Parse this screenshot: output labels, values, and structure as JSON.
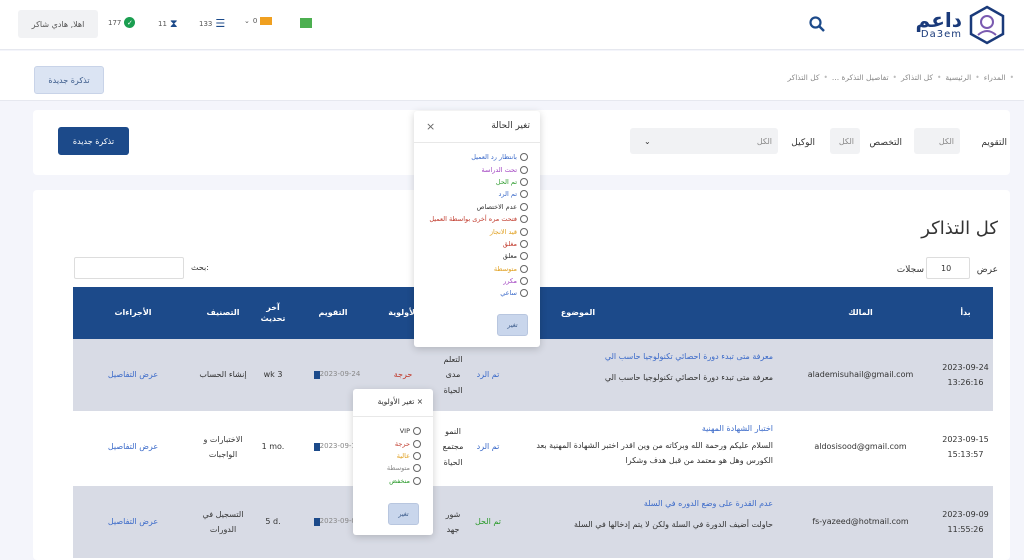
{
  "header": {
    "logo_ar": "داعم",
    "logo_en": "Da3em",
    "greeting": "اهلا, هادي شاكر",
    "stats": {
      "done_count": "177",
      "pending_count": "11",
      "list_count": "133",
      "chevron_count": "0"
    }
  },
  "subbar": {
    "new_ticket": "تذكرة جديدة",
    "breadcrumb": [
      "المدراء",
      "الرئيسية",
      "كل التذاكر",
      "تفاصيل التذكرة ...",
      "كل التذاكر"
    ]
  },
  "filters": {
    "new_ticket": "تذكرة جديدة",
    "rating_label": "التقويم",
    "rating_value": "الكل",
    "specialty_label": "التخصص",
    "specialty_value": "الكل",
    "agent_label": "الوكيل",
    "agent_value": "الكل"
  },
  "main": {
    "title": "كل التذاكر",
    "show_label": "عرض",
    "show_value": "10",
    "records_label": "سجلات",
    "search_label": "بحث:"
  },
  "table": {
    "headers": {
      "start": "بدأ",
      "owner": "المالك",
      "subject": "الموضوع",
      "priority": "الأولوية",
      "rating": "التقويم",
      "last_update": "آخر تحديث",
      "category": "التصنيف",
      "actions": "الأجراءات"
    },
    "rows": [
      {
        "date": "2023-09-24",
        "time": "13:26:16",
        "owner": "alademisuhail@gmail.com",
        "subject_title": "معرفة متى تبدء دورة احصائي تكنولوجيا حاسب الي",
        "subject_body": "معرفة متى تبدء دورة احصائي تكنولوجيا حاسب الي",
        "status": "تم الرد",
        "specialty": "التعلم مدى الحياة",
        "priority": "حرجة",
        "rating_date": "2023-09-24",
        "last_update": "wk 3",
        "category": "إنشاء الحساب",
        "action": "عرض التفاصيل"
      },
      {
        "date": "2023-09-15",
        "time": "15:13:57",
        "owner": "aldosisood@gmail.com",
        "subject_title": "اختبار الشهادة المهنية",
        "subject_body": "السلام عليكم ورحمة الله وبركاته من وين اقدر اختبر الشهادة المهنية بعد الكورس وهل هو معتمد من قبل هدف وشكرا",
        "status": "تم الرد",
        "specialty": "النمو مجتمع الحياة",
        "priority": "",
        "rating_date": "2023-09-15",
        "last_update": "1 mo.",
        "category": "الاختبارات و الواجبات",
        "action": "عرض التفاصيل"
      },
      {
        "date": "2023-09-09",
        "time": "11:55:26",
        "owner": "fs-yazeed@hotmail.com",
        "subject_title": "عدم القدرة على وضع الدوره في السلة",
        "subject_body": "حاولت أضيف الدورة في السلة ولكن لا يتم إدخالها في السلة",
        "status": "تم الحل",
        "specialty": "شور جهد",
        "priority": "",
        "rating_date": "2023-09-09",
        "last_update": "5 d.",
        "category": "التسجيل في الدورات",
        "action": "عرض التفاصيل"
      }
    ]
  },
  "status_modal": {
    "title": "تغير الحالة",
    "close": "×",
    "options": [
      {
        "label": "بانتظار رد العميل",
        "color": "#3b6ac9"
      },
      {
        "label": "تحت الدراسة",
        "color": "#a040c0"
      },
      {
        "label": "تم الحل",
        "color": "#2a9a2a"
      },
      {
        "label": "تم الرد",
        "color": "#3b6ac9"
      },
      {
        "label": "عدم الاختصاص",
        "color": "#333333"
      },
      {
        "label": "فتحت مره أخرى بواسطة العميل",
        "color": "#c0392b"
      },
      {
        "label": "قيد الانجاز",
        "color": "#e0a020"
      },
      {
        "label": "مغلق",
        "color": "#c0392b"
      },
      {
        "label": "معلق",
        "color": "#333333"
      },
      {
        "label": "متوسطة",
        "color": "#e0a020"
      },
      {
        "label": "مكرر",
        "color": "#a040c0"
      },
      {
        "label": "ساعي",
        "color": "#3b6ac9"
      }
    ],
    "button": "تغير"
  },
  "priority_modal": {
    "title": "تغير الأولوية",
    "close": "×",
    "options": [
      {
        "label": "VIP",
        "color": "#333333"
      },
      {
        "label": "حرجة",
        "color": "#c0392b"
      },
      {
        "label": "عالية",
        "color": "#e0a020"
      },
      {
        "label": "متوسطة",
        "color": "#888888"
      },
      {
        "label": "منخفض",
        "color": "#2a9a2a"
      }
    ],
    "button": "تغير"
  }
}
